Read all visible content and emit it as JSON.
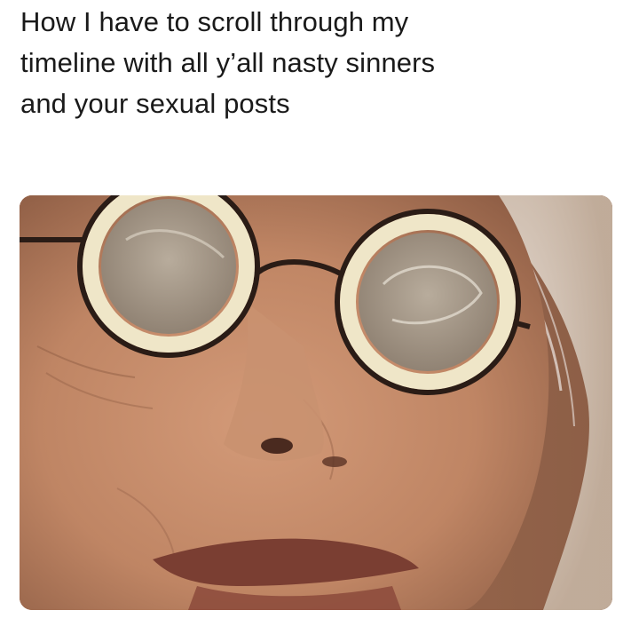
{
  "caption": {
    "lines": [
      "How I have to scroll through my",
      "timeline with all y’all nasty sinners",
      "and your sexual posts"
    ]
  },
  "photo": {
    "subject": "face-wearing-round-glasses",
    "colors": {
      "skin": "#c28a68",
      "skin_shadow": "#8f5d44",
      "background": "#9a6a4f",
      "hair": "#e8e2da",
      "lens_rim": "#efe6c8",
      "frame": "#2a1c16",
      "lips": "#7a3e32"
    }
  }
}
